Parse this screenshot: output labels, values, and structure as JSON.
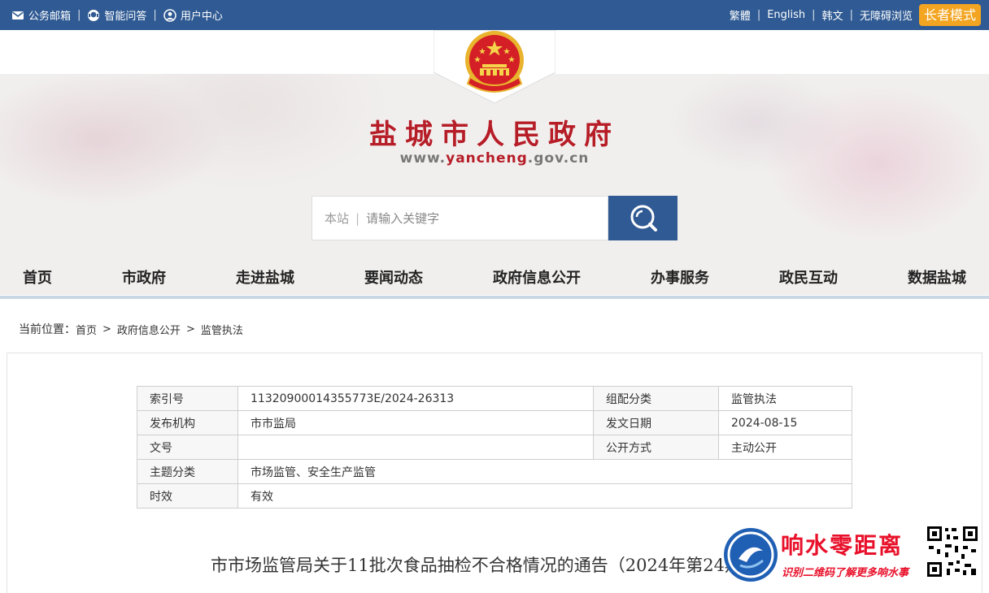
{
  "topbar": {
    "left": [
      {
        "icon": "mail-icon",
        "label": "公务邮箱"
      },
      {
        "icon": "chat-icon",
        "label": "智能问答"
      },
      {
        "icon": "user-icon",
        "label": "用户中心"
      }
    ],
    "right": [
      "繁體",
      "English",
      "韩文",
      "无障碍浏览"
    ],
    "elder_mode": "长者模式"
  },
  "header": {
    "title": "盐城市人民政府",
    "url_prefix": "www.",
    "url_highlight": "yancheng",
    "url_suffix": ".gov.cn"
  },
  "search": {
    "scope": "本站",
    "placeholder": "请输入关键字"
  },
  "nav": [
    "首页",
    "市政府",
    "走进盐城",
    "要闻动态",
    "政府信息公开",
    "办事服务",
    "政民互动",
    "数据盐城"
  ],
  "breadcrumb": {
    "label": "当前位置：",
    "items": [
      "首页",
      "政府信息公开",
      "监管执法"
    ]
  },
  "meta": {
    "index_label": "索引号",
    "index_value": "11320900014355773E/2024-26313",
    "category_label": "组配分类",
    "category_value": "监管执法",
    "issuer_label": "发布机构",
    "issuer_value": "市市监局",
    "date_label": "发文日期",
    "date_value": "2024-08-15",
    "docno_label": "文号",
    "docno_value": "",
    "disclosure_label": "公开方式",
    "disclosure_value": "主动公开",
    "topic_label": "主题分类",
    "topic_value": "市场监管、安全生产监管",
    "validity_label": "时效",
    "validity_value": "有效"
  },
  "article": {
    "title": "市市场监管局关于11批次食品抽检不合格情况的通告（2024年第24期）"
  },
  "watermark": {
    "name": "响水零距离",
    "sub": "识别二维码了解更多响水事"
  },
  "colors": {
    "brand_blue": "#2f5a93",
    "title_red": "#b61d27",
    "elder_orange": "#f3a521"
  }
}
